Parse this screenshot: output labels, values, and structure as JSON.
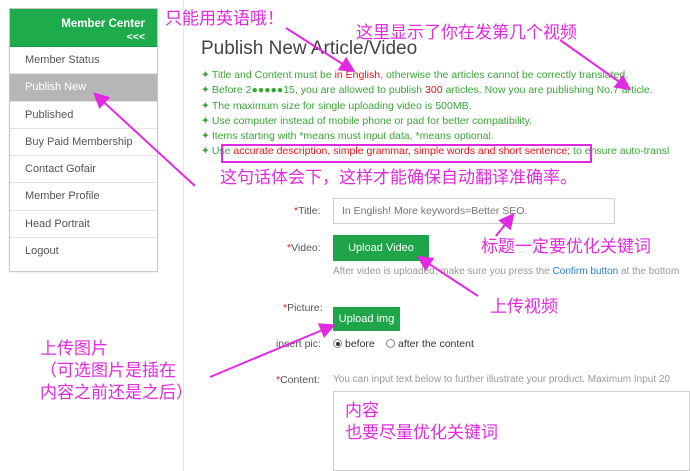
{
  "sidebar": {
    "title": "Member Center",
    "collapse_glyph": "<<<",
    "items": [
      {
        "label": "Member Status",
        "active": false
      },
      {
        "label": "Publish New",
        "active": true
      },
      {
        "label": "Published",
        "active": false
      },
      {
        "label": "Buy Paid Membership",
        "active": false
      },
      {
        "label": "Contact Gofair",
        "active": false
      },
      {
        "label": "Member Profile",
        "active": false
      },
      {
        "label": "Head Portrait",
        "active": false
      },
      {
        "label": "Logout",
        "active": false
      }
    ]
  },
  "main": {
    "page_title": "Publish New Article/Video",
    "rules": [
      {
        "pre": "Title and Content must be ",
        "red": "in English",
        "post": ", otherwise the articles cannot be correctly translated."
      },
      {
        "pre": "Before 2●●●●●15, you are allowed to publish ",
        "red": "300",
        "post": " articles. Now you are publishing No.7 article."
      },
      {
        "pre": "The maximum size for single uploading video is 500MB.",
        "red": "",
        "post": ""
      },
      {
        "pre": "Use computer instead of mobile phone or pad for better compatibility.",
        "red": "",
        "post": ""
      },
      {
        "pre": "Items starting with *means must input data, *means optional.",
        "red": "",
        "post": ""
      },
      {
        "pre": "Use ",
        "red": "accurate description, simple grammar, simple words and short sentence;",
        "post": " to ensure auto-transl"
      }
    ],
    "bullet": "✦"
  },
  "form": {
    "title_label": "Title:",
    "title_placeholder": "In English! More keywords=Better SEO.",
    "video_label": "Video:",
    "video_button": "Upload Video",
    "video_hint_pre": "After video is uploaded, make sure you press the ",
    "video_hint_link": "Confirm button",
    "video_hint_post": " at the bottom",
    "picture_label": "Picture:",
    "picture_button": "Upload img",
    "insert_pic_label": "insert pic:",
    "insert_options": [
      {
        "label": "before",
        "selected": true
      },
      {
        "label": "after the content",
        "selected": false
      }
    ],
    "content_label": "Content:",
    "content_hint": "You can input text below to further illustrate your product. Maximum Input 20",
    "required_mark": "*"
  },
  "annotations": {
    "english_only": "只能用英语哦！",
    "video_number": "这里显示了你在发第几个视频",
    "sentence_note": "这句话体会下，这样才能确保自动翻译准确率。",
    "title_keywords": "标题一定要优化关键词",
    "upload_video": "上传视频",
    "upload_picture_l1": "上传图片",
    "upload_picture_l2": "（可选图片是插在",
    "upload_picture_l3": "内容之前还是之后）",
    "content_l1": "内容",
    "content_l2": "也要尽量优化关键词",
    "color": "#e22be0"
  },
  "colors": {
    "accent": "#1dab4c",
    "button": "#1ea54a",
    "rule_text": "#3aa636",
    "required": "#e11111"
  }
}
